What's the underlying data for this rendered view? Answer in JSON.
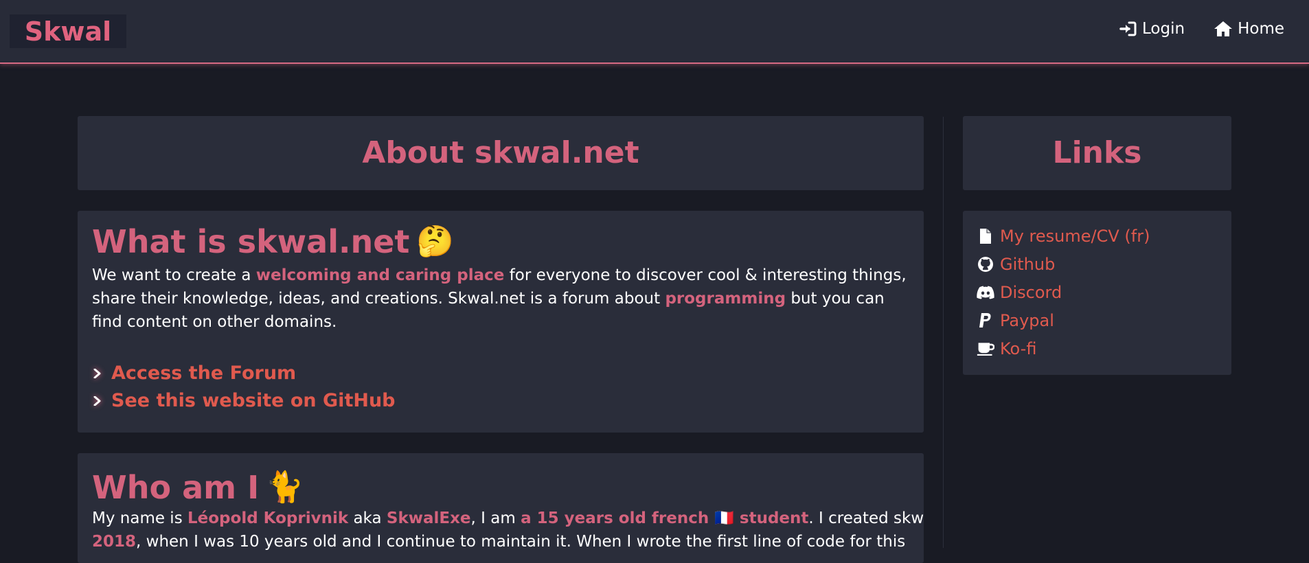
{
  "header": {
    "brand": "Skwal",
    "nav": [
      {
        "label": "Login",
        "icon": "login-icon"
      },
      {
        "label": "Home",
        "icon": "home-icon"
      }
    ],
    "accent_color": "#d86a84"
  },
  "main": {
    "about_title": "About skwal.net",
    "what": {
      "title": "What is skwal.net",
      "emoji": "🤔",
      "para": [
        {
          "text": "We want to create a ",
          "hl": false
        },
        {
          "text": "welcoming and caring place",
          "hl": true
        },
        {
          "text": " for everyone to discover cool & interesting things, share their knowledge, ideas, and creations. Skwal.net is a forum about ",
          "hl": false
        },
        {
          "text": "programming",
          "hl": true
        },
        {
          "text": " but you can find content on other domains.",
          "hl": false
        }
      ],
      "links": [
        {
          "label": "Access the Forum"
        },
        {
          "label": "See this website on GitHub"
        }
      ]
    },
    "who": {
      "title": "Who am I",
      "emoji": "🐈",
      "line1": [
        {
          "text": "My name is ",
          "hl": false
        },
        {
          "text": "Léopold Koprivnik",
          "hl": true
        },
        {
          "text": " aka ",
          "hl": false
        },
        {
          "text": "SkwalExe",
          "hl": true
        },
        {
          "text": ", I am ",
          "hl": false
        },
        {
          "text": "a 15 years old french 🇫🇷 student",
          "hl": true
        },
        {
          "text": ". I created skwal.net in",
          "hl": false
        }
      ],
      "line2": [
        {
          "text": "2018",
          "hl": true
        },
        {
          "text": ", when I was 10 years old and I continue to maintain it. When I wrote the first line of code for this",
          "hl": false
        }
      ]
    }
  },
  "sidebar": {
    "title": "Links",
    "links": [
      {
        "label": "My resume/CV (fr)",
        "icon": "file-icon"
      },
      {
        "label": "Github",
        "icon": "github-icon"
      },
      {
        "label": "Discord",
        "icon": "discord-icon"
      },
      {
        "label": "Paypal",
        "icon": "paypal-icon"
      },
      {
        "label": "Ko-fi",
        "icon": "coffee-icon"
      }
    ]
  }
}
